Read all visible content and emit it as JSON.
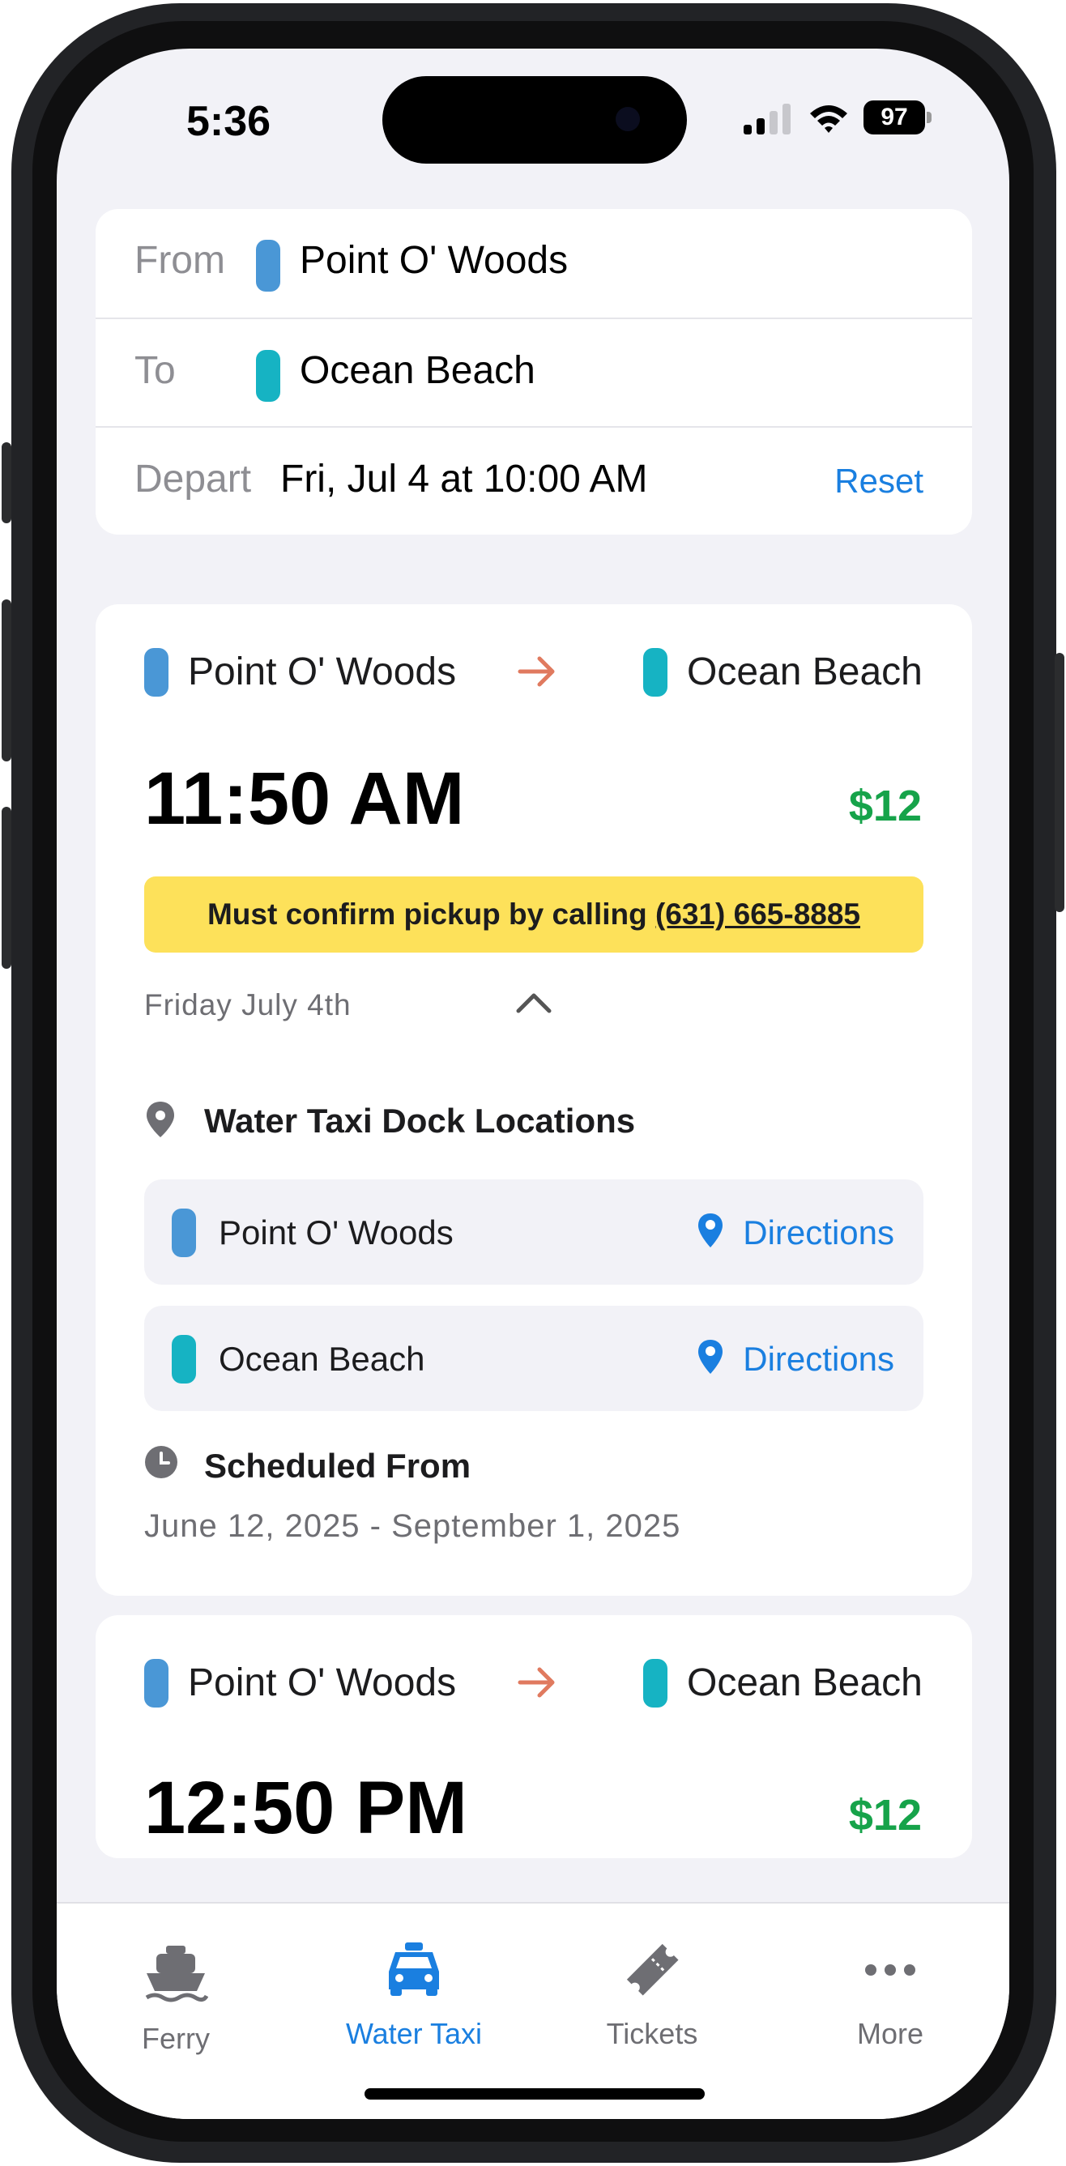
{
  "status_bar": {
    "time": "5:36",
    "battery": "97"
  },
  "search": {
    "from_label": "From",
    "from_value": "Point O' Woods",
    "to_label": "To",
    "to_value": "Ocean Beach",
    "depart_label": "Depart",
    "depart_value": "Fri, Jul 4 at 10:00 AM",
    "reset_label": "Reset"
  },
  "colors": {
    "from_stop": "#4a97d6",
    "to_stop": "#16b3c3",
    "accent": "#1a7fe0",
    "price": "#16a34a",
    "arrow": "#e07a5f",
    "banner": "#fde15a"
  },
  "trips": [
    {
      "from": "Point O' Woods",
      "to": "Ocean Beach",
      "time": "11:50 AM",
      "price": "$12",
      "notice_prefix": "Must confirm pickup by calling ",
      "notice_phone": "(631) 665-8885",
      "date": "Friday July 4th",
      "dock_title": "Water Taxi Dock Locations",
      "docks": [
        {
          "name": "Point O' Woods",
          "action": "Directions"
        },
        {
          "name": "Ocean Beach",
          "action": "Directions"
        }
      ],
      "schedule_title": "Scheduled From",
      "schedule_range": "June 12, 2025 - September 1, 2025"
    },
    {
      "from": "Point O' Woods",
      "to": "Ocean Beach",
      "time": "12:50 PM",
      "price": "$12"
    }
  ],
  "tabs": [
    {
      "label": "Ferry",
      "icon": "ferry-icon"
    },
    {
      "label": "Water Taxi",
      "icon": "taxi-icon",
      "active": true
    },
    {
      "label": "Tickets",
      "icon": "ticket-icon"
    },
    {
      "label": "More",
      "icon": "more-icon"
    }
  ]
}
